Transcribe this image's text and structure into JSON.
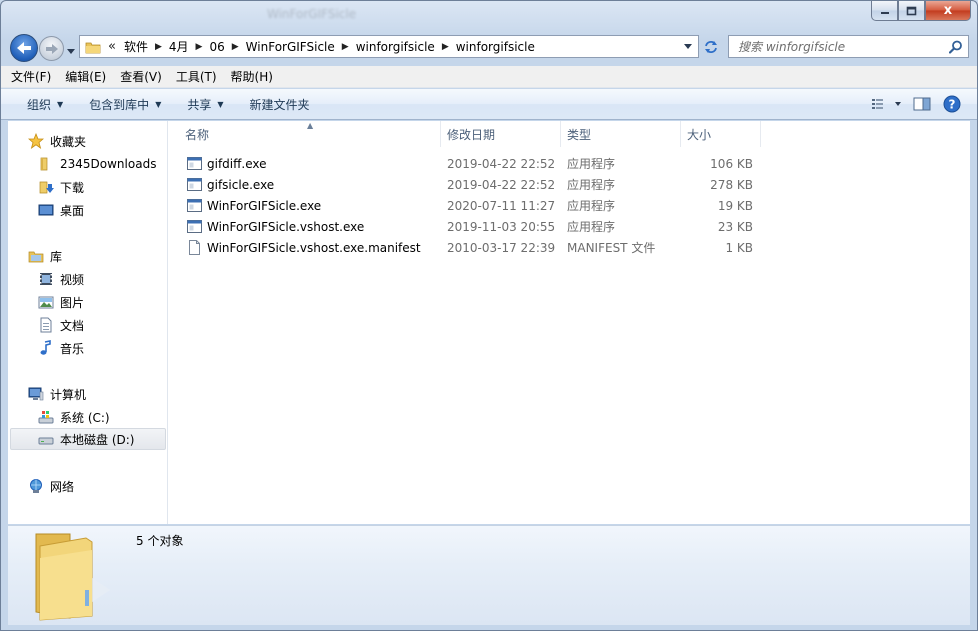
{
  "window": {
    "title": "WinForGIFSicle"
  },
  "caption": {
    "close_glyph": "x"
  },
  "address": {
    "overflow": "«",
    "crumbs": [
      "软件",
      "4月",
      "06",
      "WinForGIFSicle",
      "winforgifsicle",
      "winforgifsicle"
    ]
  },
  "search": {
    "placeholder": "搜索 winforgifsicle"
  },
  "menu": [
    "文件(F)",
    "编辑(E)",
    "查看(V)",
    "工具(T)",
    "帮助(H)"
  ],
  "commands": {
    "organize": "组织",
    "include_in_library": "包含到库中",
    "share": "共享",
    "new_folder": "新建文件夹"
  },
  "nav": {
    "favorites": "收藏夹",
    "downloads_2345": "2345Downloads",
    "downloads": "下载",
    "desktop": "桌面",
    "libraries": "库",
    "videos": "视频",
    "pictures": "图片",
    "documents": "文档",
    "music": "音乐",
    "computer": "计算机",
    "drive_c": "系统 (C:)",
    "drive_d": "本地磁盘 (D:)",
    "network": "网络"
  },
  "columns": {
    "name": "名称",
    "date": "修改日期",
    "type": "类型",
    "size": "大小"
  },
  "files": [
    {
      "name": "gifdiff.exe",
      "date": "2019-04-22 22:52",
      "type": "应用程序",
      "size": "106 KB",
      "icon": "exe-icon"
    },
    {
      "name": "gifsicle.exe",
      "date": "2019-04-22 22:52",
      "type": "应用程序",
      "size": "278 KB",
      "icon": "exe-icon"
    },
    {
      "name": "WinForGIFSicle.exe",
      "date": "2020-07-11 11:27",
      "type": "应用程序",
      "size": "19 KB",
      "icon": "exe-icon"
    },
    {
      "name": "WinForGIFSicle.vshost.exe",
      "date": "2019-11-03 20:55",
      "type": "应用程序",
      "size": "23 KB",
      "icon": "exe-icon"
    },
    {
      "name": "WinForGIFSicle.vshost.exe.manifest",
      "date": "2010-03-17 22:39",
      "type": "MANIFEST 文件",
      "size": "1 KB",
      "icon": "file-icon"
    }
  ],
  "details": {
    "count": "5 个对象"
  },
  "colors": {
    "accent": "#1f5fb9",
    "folder": "#f0cf6b",
    "close": "#c23b1e"
  }
}
